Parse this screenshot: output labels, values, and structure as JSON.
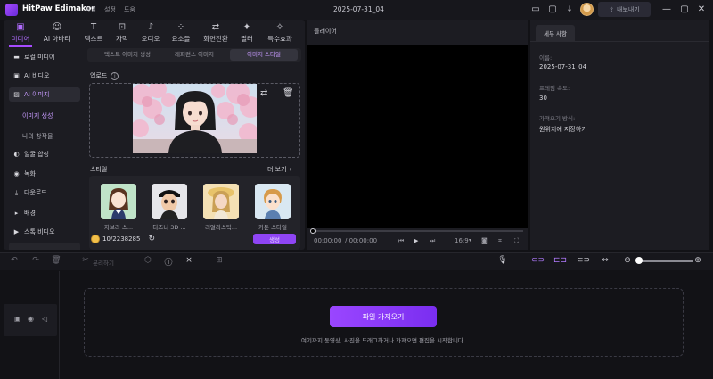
{
  "app": {
    "name": "HitPaw Edimakor",
    "menu": [
      "파일",
      "설정",
      "도움"
    ],
    "doc_title": "2025-07-31_04",
    "export_label": "내보내기"
  },
  "top_tabs": [
    {
      "label": "미디어",
      "icon": "media-icon",
      "active": true
    },
    {
      "label": "AI 아바타",
      "icon": "ai-avatar-icon"
    },
    {
      "label": "텍스트",
      "icon": "text-icon"
    },
    {
      "label": "자막",
      "icon": "subtitle-icon"
    },
    {
      "label": "오디오",
      "icon": "audio-icon"
    },
    {
      "label": "요소들",
      "icon": "elements-icon"
    },
    {
      "label": "화면전환",
      "icon": "transition-icon"
    },
    {
      "label": "필터",
      "icon": "filter-icon"
    },
    {
      "label": "특수효과",
      "icon": "effects-icon"
    }
  ],
  "sidebar": {
    "items": [
      {
        "label": "로컬 미디어"
      },
      {
        "label": "AI 비디오"
      },
      {
        "label": "AI 이미지"
      },
      {
        "label": "얼굴 합성"
      },
      {
        "label": "녹화"
      },
      {
        "label": "다운로드"
      },
      {
        "label": "배경"
      },
      {
        "label": "스톡 비디오"
      }
    ],
    "sub_items": [
      "이미지 생성",
      "나의 창작물"
    ]
  },
  "image_tabs": [
    "텍스트 이미지 생성",
    "레퍼런스 이미지",
    "이미지 스타일"
  ],
  "upload": {
    "label": "업로드"
  },
  "styles": {
    "label": "스타일",
    "more": "더 보기",
    "cards": [
      {
        "name": "지브리 스..."
      },
      {
        "name": "디즈니 3D ..."
      },
      {
        "name": "리얼리스틱..."
      },
      {
        "name": "카툰 스타일"
      }
    ]
  },
  "credits": {
    "used": "10",
    "total": "/2238285"
  },
  "generate_label": "생성",
  "player": {
    "tab": "플레이어",
    "time_current": "00:00:00",
    "time_total": "/ 00:00:00",
    "aspect": "16:9"
  },
  "details": {
    "tab": "세부 사항",
    "name_label": "이름:",
    "name_value": "2025-07-31_04",
    "fps_label": "프레임 속도:",
    "fps_value": "30",
    "save_label": "가져오기 방식:",
    "save_value": "원위치에 저장하기"
  },
  "toolbar": {
    "split_label": "분리하기"
  },
  "timeline": {
    "import_label": "파일 가져오기",
    "drop_hint": "여기까지 동영상, 사진을 드래그하거나 가져오면 편집을 시작합니다."
  },
  "colors": {
    "accent": "#a64bff",
    "bg": "#121216",
    "panel": "#1c1c22"
  }
}
